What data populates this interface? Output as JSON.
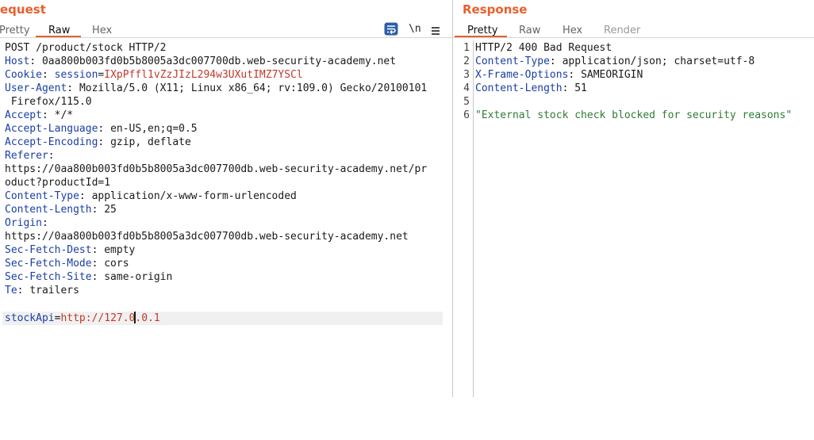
{
  "request": {
    "title": "equest",
    "tabs": [
      "Pretty",
      "Raw",
      "Hex"
    ],
    "active_tab": "Raw",
    "toolbar_icons": [
      "wrap-lines-icon",
      "newline-toggle-icon",
      "menu-icon"
    ],
    "newline_label": "\\n",
    "lines": {
      "l1": "POST /product/stock HTTP/2",
      "host_name": "Host",
      "host_value": "0aa800b003fd0b5b8005a3dc007700db.web-security-academy.net",
      "cookie_name": "Cookie",
      "cookie_key": "session",
      "cookie_eq": "=",
      "cookie_value": "IXpPffl1vZzJIzL294w3UXutIMZ7YSCl",
      "ua_name": "User-Agent",
      "ua_value": "Mozilla/5.0 (X11; Linux x86_64; rv:109.0) Gecko/20100101",
      "ua_cont": " Firefox/115.0",
      "accept_name": "Accept",
      "accept_value": "*/*",
      "al_name": "Accept-Language",
      "al_value": "en-US,en;q=0.5",
      "ae_name": "Accept-Encoding",
      "ae_value": "gzip, deflate",
      "ref_name": "Referer",
      "ref_value1": "https://0aa800b003fd0b5b8005a3dc007700db.web-security-academy.net/pr",
      "ref_value2": "oduct?productId=1",
      "ct_name": "Content-Type",
      "ct_value": "application/x-www-form-urlencoded",
      "cl_name": "Content-Length",
      "cl_value": "25",
      "origin_name": "Origin",
      "origin_value": "https://0aa800b003fd0b5b8005a3dc007700db.web-security-academy.net",
      "sfd_name": "Sec-Fetch-Dest",
      "sfd_value": "empty",
      "sfm_name": "Sec-Fetch-Mode",
      "sfm_value": "cors",
      "sfs_name": "Sec-Fetch-Site",
      "sfs_value": "same-origin",
      "te_name": "Te",
      "te_value": "trailers",
      "body_key": "stockApi",
      "body_eq": "=",
      "body_value_a": "http://127.0",
      "body_value_b": ".0.1"
    }
  },
  "response": {
    "title": "Response",
    "tabs": [
      "Pretty",
      "Raw",
      "Hex",
      "Render"
    ],
    "active_tab": "Pretty",
    "line_numbers": [
      "1",
      "2",
      "3",
      "4",
      "5",
      "6"
    ],
    "status_line": "HTTP/2 400 Bad Request",
    "ct_name": "Content-Type",
    "ct_value": "application/json; charset=utf-8",
    "xfo_name": "X-Frame-Options",
    "xfo_value": "SAMEORIGIN",
    "cl_name": "Content-Length",
    "cl_value": "51",
    "body": "\"External stock check blocked for security reasons\""
  }
}
